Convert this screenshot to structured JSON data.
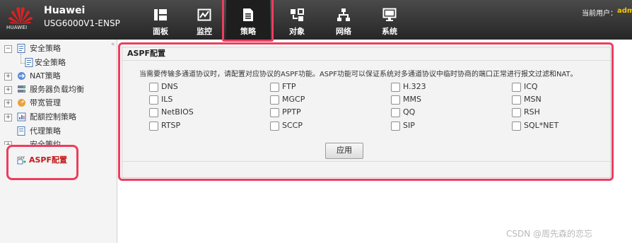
{
  "header": {
    "brand": "Huawei",
    "model": "USG6000V1-ENSP",
    "logo_text": "HUAWEI",
    "user_label": "当前用户：",
    "user_value": "adm",
    "nav": [
      {
        "label": "面板",
        "icon": "dashboard-icon"
      },
      {
        "label": "监控",
        "icon": "monitor-chart-icon"
      },
      {
        "label": "策略",
        "icon": "policy-document-icon",
        "active": true
      },
      {
        "label": "对象",
        "icon": "object-icon"
      },
      {
        "label": "网络",
        "icon": "network-icon"
      },
      {
        "label": "系统",
        "icon": "system-monitor-icon"
      }
    ]
  },
  "sidebar": {
    "items": [
      {
        "label": "安全策略",
        "expander": "−"
      },
      {
        "label": "安全策略"
      },
      {
        "label": "NAT策略",
        "expander": "+"
      },
      {
        "label": "服务器负载均衡",
        "expander": "+"
      },
      {
        "label": "带宽管理",
        "expander": "+"
      },
      {
        "label": "配额控制策略",
        "expander": "+"
      },
      {
        "label": "代理策略"
      },
      {
        "label": "安全策约",
        "expander": "+"
      },
      {
        "label": "ASPF配置",
        "selected": true
      }
    ],
    "collapse_glyph": "«"
  },
  "panel": {
    "title": "ASPF配置",
    "description": "当需要传输多通道协议时，请配置对应协议的ASPF功能。ASPF功能可以保证系统对多通道协议中临时协商的端口正常进行报文过滤和NAT。",
    "options": [
      [
        "DNS",
        "FTP",
        "H.323",
        "ICQ"
      ],
      [
        "ILS",
        "MGCP",
        "MMS",
        "MSN"
      ],
      [
        "NetBIOS",
        "PPTP",
        "QQ",
        "RSH"
      ],
      [
        "RTSP",
        "SCCP",
        "SIP",
        "SQL*NET"
      ]
    ],
    "apply_label": "应用"
  },
  "watermark": "CSDN @周先森的恋忘",
  "colors": {
    "highlight": "#ec3e5e",
    "header_bg": "#2e2e2e",
    "user_value": "#f2c500",
    "selected_text": "#c41a1a"
  }
}
